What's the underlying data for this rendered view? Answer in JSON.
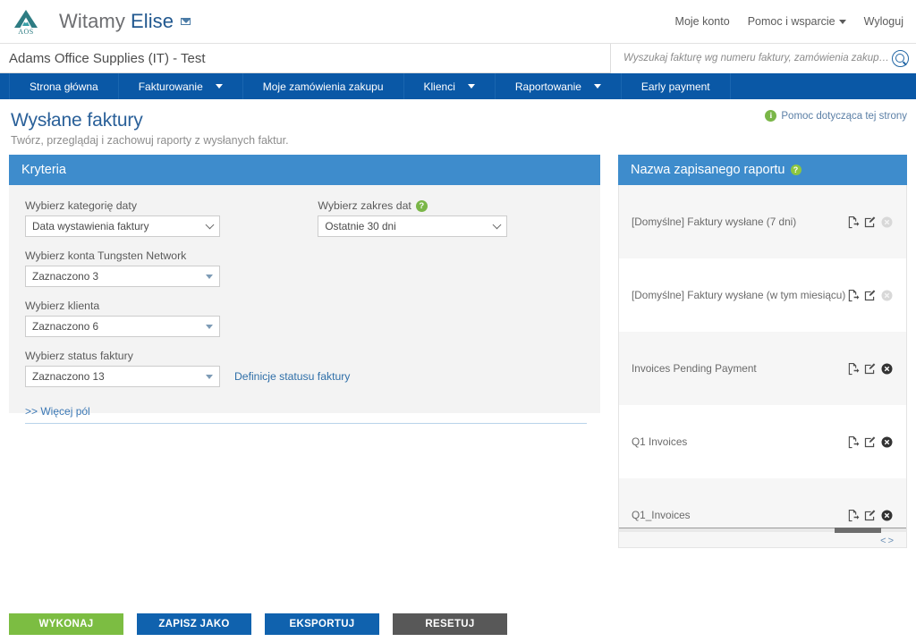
{
  "brand": {
    "logo_text": "AOS",
    "logo_color": "#2e7c83"
  },
  "topbar": {
    "welcome_prefix": "Witamy",
    "welcome_name": "Elise",
    "links": [
      {
        "label": "Moje konto",
        "has_caret": false
      },
      {
        "label": "Pomoc i wsparcie",
        "has_caret": true
      },
      {
        "label": "Wyloguj",
        "has_caret": false
      }
    ]
  },
  "companybar": {
    "company": "Adams Office Supplies (IT) - Test",
    "search_placeholder": "Wyszukaj fakturę wg numeru faktury, zamówienia zakupu, transakcj",
    "search_value": ""
  },
  "nav": {
    "accent": "#0a58a6",
    "items": [
      {
        "label": "Strona główna",
        "has_caret": false
      },
      {
        "label": "Fakturowanie",
        "has_caret": true
      },
      {
        "label": "Moje zamówienia zakupu",
        "has_caret": false
      },
      {
        "label": "Klienci",
        "has_caret": true
      },
      {
        "label": "Raportowanie",
        "has_caret": true
      },
      {
        "label": "Early payment",
        "has_caret": false
      }
    ]
  },
  "page": {
    "title": "Wysłane faktury",
    "subtitle": "Twórz, przeglądaj i zachowuj raporty z wysłanych faktur.",
    "help_label": "Pomoc dotycząca tej strony",
    "help_icon": "info-icon"
  },
  "criteria": {
    "panel_title": "Kryteria",
    "fields": {
      "date_category": {
        "label": "Wybierz kategorię daty",
        "value": "Data wystawienia faktury"
      },
      "date_range": {
        "label": "Wybierz zakres dat",
        "value": "Ostatnie 30 dni",
        "help_icon": "question-icon"
      },
      "accounts": {
        "label": "Wybierz konta Tungsten Network",
        "value": "Zaznaczono 3"
      },
      "customer": {
        "label": "Wybierz klienta",
        "value": "Zaznaczono 6"
      },
      "invoice_status": {
        "label": "Wybierz status faktury",
        "value": "Zaznaczono 13",
        "side_link": "Definicje statusu faktury"
      }
    },
    "more_fields_label": ">> Więcej pól"
  },
  "saved_reports": {
    "panel_title": "Nazwa zapisanego raportu",
    "help_icon": "question-icon",
    "rows": [
      {
        "name": "[Domyślne] Faktury wysłane (7 dni)",
        "deletable": false
      },
      {
        "name": "[Domyślne] Faktury wysłane (w tym miesiącu)",
        "deletable": false
      },
      {
        "name": "Invoices Pending Payment",
        "deletable": true
      },
      {
        "name": "Q1 Invoices",
        "deletable": true
      },
      {
        "name": "Q1_Invoices",
        "deletable": true
      }
    ],
    "action_icons": [
      "run-report-icon",
      "edit-report-icon",
      "delete-report-icon"
    ],
    "pager_prev": "<",
    "pager_next": ">"
  },
  "footer": {
    "buttons": [
      {
        "label": "WYKONAJ",
        "color": "#7cbd42",
        "style": "green"
      },
      {
        "label": "ZAPISZ JAKO",
        "color": "#1062ae",
        "style": "blue"
      },
      {
        "label": "EKSPORTUJ",
        "color": "#1062ae",
        "style": "blue"
      },
      {
        "label": "RESETUJ",
        "color": "#585858",
        "style": "gray"
      }
    ]
  }
}
